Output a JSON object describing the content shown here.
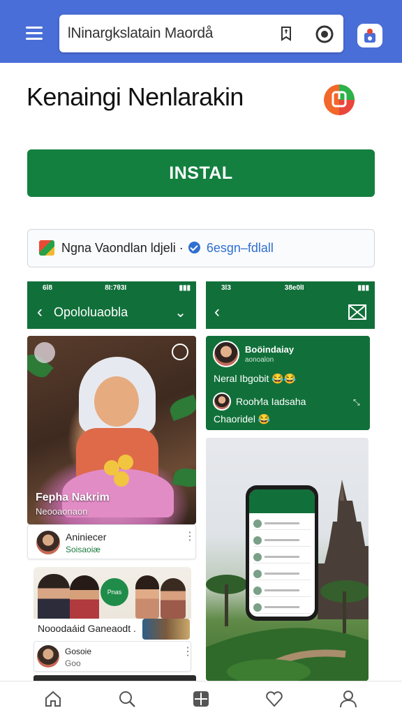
{
  "browser": {
    "url": "lNinargkslatain Maordå",
    "menu_icon": "hamburger-menu-icon",
    "bookmark_icon": "bookmark-icon",
    "lens_icon": "camera-lens-icon",
    "tabs_icon": "tabs-icon"
  },
  "app": {
    "title": "Kenaingi Nenlarakin",
    "logo_icon": "app-logo-icon",
    "install_label": "INSTAL",
    "developer_text": "Ngna Vaondlan ldjeli ·",
    "developer_link": "6esgn–fdlall",
    "accent_color": "#13803f",
    "header_color": "#4a6ed8"
  },
  "screenshots": {
    "left": {
      "status_left": "6l8",
      "status_center": "8I:7θ3I",
      "title": "Opololuaobla",
      "photo_caption": "Fepha Nakrim",
      "photo_subcaption": "Neooaonaon",
      "card1_title": "Aniniecer",
      "card1_subtitle": "Soisaoiæ",
      "card2_caption": "Nooodaáid Ganeaodt .",
      "card2_bubble": "Pnas",
      "card3_title": "Gosoie",
      "card3_subtitle": "Goo"
    },
    "right": {
      "status_left": "3l3",
      "status_center": "38e0lI",
      "chat_name": "Boöindaiay",
      "chat_time": "aonoalon",
      "chat_message_1": "Neral Ibgobit 😂😂",
      "chat_name_2": "Rooh⁄la Iadsaha",
      "chat_message_2": "Chaoridel 😂"
    }
  },
  "bottom_nav": [
    {
      "icon": "home-icon"
    },
    {
      "icon": "search-icon"
    },
    {
      "icon": "apps-icon"
    },
    {
      "icon": "heart-icon"
    },
    {
      "icon": "profile-icon"
    }
  ]
}
